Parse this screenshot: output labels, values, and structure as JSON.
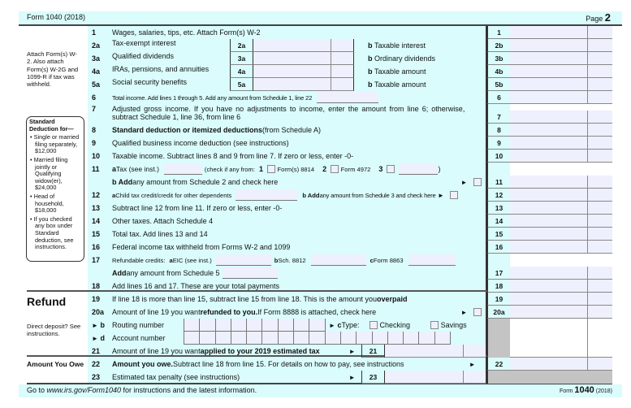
{
  "header": {
    "form_title": "Form 1040 (2018)",
    "page_label": "Page",
    "page_number": "2"
  },
  "left": {
    "attach_note": "Attach Form(s) W-2. Also attach Form(s) W-2G and 1099-R if tax was withheld.",
    "std_deduction": {
      "title": "Standard Deduction for—",
      "items": [
        "Single or married filing separately, $12,000",
        "Married filing jointly or Qualifying widow(er), $24,000",
        "Head of household, $18,000",
        "If you checked any box under Standard deduction, see instructions."
      ]
    },
    "refund_heading": "Refund",
    "direct_deposit": "Direct deposit? See instructions.",
    "amount_you_owe": "Amount You Owe"
  },
  "lines": {
    "l1": {
      "num": "1",
      "text": "Wages, salaries, tips, etc. Attach Form(s) W-2"
    },
    "l2": {
      "num": "2a",
      "text": "Tax-exempt interest",
      "box": "2a",
      "b_letter": "b",
      "b_text": "Taxable interest"
    },
    "l3": {
      "num": "3a",
      "text": "Qualified dividends",
      "box": "3a",
      "b_letter": "b",
      "b_text": "Ordinary dividends"
    },
    "l4": {
      "num": "4a",
      "text": "IRAs, pensions, and annuities",
      "box": "4a",
      "b_letter": "b",
      "b_text": "Taxable amount"
    },
    "l5": {
      "num": "5a",
      "text": "Social security benefits",
      "box": "5a",
      "b_letter": "b",
      "b_text": "Taxable amount"
    },
    "l6": {
      "num": "6",
      "text": "Total income. Add lines 1 through 5. Add any amount from Schedule 1, line 22"
    },
    "l7": {
      "num": "7",
      "text1": "Adjusted gross income. If you have no adjustments to income, enter the amount from line 6; otherwise,",
      "text2": "subtract Schedule 1, line 36, from line 6"
    },
    "l8": {
      "num": "8",
      "bold": "Standard deduction or itemized deductions",
      "text": " (from Schedule A)"
    },
    "l9": {
      "num": "9",
      "text": "Qualified business income deduction (see instructions)"
    },
    "l10": {
      "num": "10",
      "text": "Taxable income. Subtract lines 8 and 9 from line 7. If zero or less, enter -0-"
    },
    "l11": {
      "num": "11",
      "a_letter": "a",
      "a_text": " Tax (see inst.)",
      "check_text": "(check if any from:",
      "opt1": "1",
      "opt1_label": "Form(s) 8814",
      "opt2": "2",
      "opt2_label": "Form 4972",
      "opt3": "3",
      "close": ")",
      "b_bold": "b Add",
      "b_text": " any amount from Schedule 2 and check here"
    },
    "l12": {
      "num": "12",
      "a_letter": "a",
      "a_text": " Child tax credit/credit for other dependents",
      "b_bold": "b Add",
      "b_text": " any amount from Schedule 3 and check here"
    },
    "l13": {
      "num": "13",
      "text": "Subtract line 12 from line 11. If zero or less, enter -0-"
    },
    "l14": {
      "num": "14",
      "text": "Other taxes. Attach Schedule 4"
    },
    "l15": {
      "num": "15",
      "text": "Total tax. Add lines 13 and 14"
    },
    "l16": {
      "num": "16",
      "text": "Federal income tax withheld from Forms W-2 and 1099"
    },
    "l17": {
      "num": "17",
      "text": "Refundable credits:",
      "a_letter": "a",
      "a_text": " EIC (see inst.)",
      "b_letter": "b",
      "b_text": " Sch. 8812",
      "c_letter": "c",
      "c_text": " Form 8863",
      "add_bold": "Add",
      "add_text": " any amount from Schedule 5"
    },
    "l18": {
      "num": "18",
      "text": "Add lines 16 and 17. These are your total payments"
    },
    "l19": {
      "num": "19",
      "text": "If line 18 is more than line 15, subtract line 15 from line 18. This is the amount you ",
      "bold": "overpaid"
    },
    "l20a": {
      "num": "20a",
      "text": "Amount of line 19 you want ",
      "bold": "refunded to you.",
      "text2": " If Form 8888 is attached, check here"
    },
    "l20b": {
      "num": "b",
      "text": "Routing number",
      "c_letter": "c",
      "c_text": " Type:",
      "checking": "Checking",
      "savings": "Savings"
    },
    "l20d": {
      "num": "d",
      "text": "Account number"
    },
    "l21": {
      "num": "21",
      "text": "Amount of line 19 you want ",
      "bold": "applied to your 2019 estimated tax",
      "box": "21"
    },
    "l22": {
      "num": "22",
      "bold": "Amount you owe.",
      "text": " Subtract line 18 from line 15. For details on how to pay, see instructions"
    },
    "l23": {
      "num": "23",
      "text": "Estimated tax penalty (see instructions)",
      "box": "23"
    }
  },
  "right_column": [
    "1",
    "2b",
    "3b",
    "4b",
    "5b",
    "6",
    "7",
    "8",
    "9",
    "10",
    "11",
    "12",
    "13",
    "14",
    "15",
    "16",
    "17",
    "18",
    "19",
    "20a",
    "22"
  ],
  "footer": {
    "text1": "Go to ",
    "url": "www.irs.gov/Form1040",
    "text2": " for instructions and the latest information.",
    "form_word": "Form",
    "form_number": "1040",
    "year": "(2018)"
  }
}
